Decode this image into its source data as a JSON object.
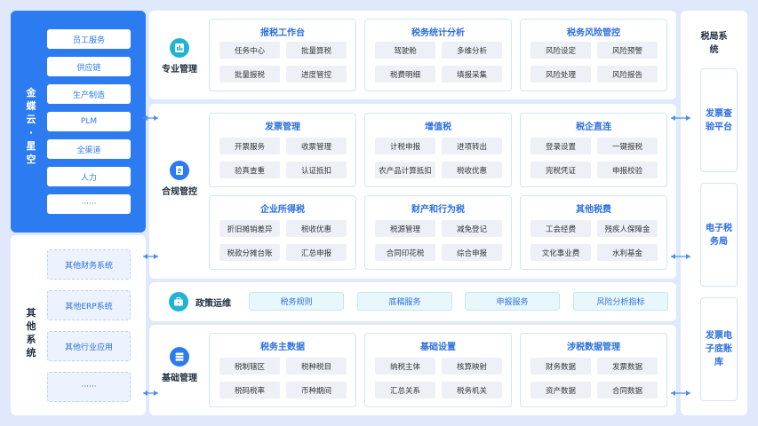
{
  "left": {
    "cloud_title": "金蝶云·星空",
    "cloud_items": [
      "员工服务",
      "供应链",
      "生产制造",
      "PLM",
      "全渠道",
      "人力",
      "······"
    ],
    "other_title": "其他系统",
    "other_items": [
      "其他财务系统",
      "其他ERP系统",
      "其他行业应用",
      "······"
    ]
  },
  "sections": {
    "professional": "专业管理",
    "compliance": "合规管控",
    "policy": "政策运维",
    "basic": "基础管理"
  },
  "boxes": {
    "tax_desk": {
      "title": "报税工作台",
      "items": [
        "任务中心",
        "批量算税",
        "批量报税",
        "进度管控"
      ]
    },
    "tax_stats": {
      "title": "税务统计分析",
      "items": [
        "驾驶舱",
        "多维分析",
        "税费明细",
        "填报采集"
      ]
    },
    "tax_risk": {
      "title": "税务风险管控",
      "items": [
        "风险设定",
        "风险预警",
        "风险处理",
        "风险报告"
      ]
    },
    "invoice": {
      "title": "发票管理",
      "items": [
        "开票服务",
        "收票管理",
        "验真查重",
        "认证抵扣"
      ]
    },
    "vat": {
      "title": "增值税",
      "items": [
        "计税申报",
        "进项转出",
        "农产品计算抵扣",
        "税收优惠"
      ]
    },
    "direct": {
      "title": "税企直连",
      "items": [
        "登录设置",
        "一键报税",
        "完税凭证",
        "申报校验"
      ]
    },
    "cit": {
      "title": "企业所得税",
      "items": [
        "折旧摊销差异",
        "税收优惠",
        "税款分摊台账",
        "汇总申报"
      ]
    },
    "property": {
      "title": "财产和行为税",
      "items": [
        "税源管理",
        "减免登记",
        "合同印花税",
        "综合申报"
      ]
    },
    "other_fees": {
      "title": "其他税费",
      "items": [
        "工会经费",
        "残疾人保障金",
        "文化事业费",
        "水利基金"
      ]
    },
    "master": {
      "title": "税务主数据",
      "items": [
        "税制辖区",
        "税种税目",
        "税码税率",
        "币种期间"
      ]
    },
    "basic_set": {
      "title": "基础设置",
      "items": [
        "纳税主体",
        "核算映射",
        "汇总关系",
        "税务机关"
      ]
    },
    "tax_data": {
      "title": "涉税数据管理",
      "items": [
        "财务数据",
        "发票数据",
        "资产数据",
        "合同数据"
      ]
    }
  },
  "policy_items": [
    "税务规则",
    "底稿服务",
    "申报服务",
    "风险分析指标"
  ],
  "right": {
    "title": "税局系统",
    "items": [
      "发票查验平台",
      "电子税务局",
      "发票电子底账库"
    ]
  },
  "colors": {
    "primary": "#2c7bf0",
    "background": "#dfe9fb",
    "chip": "#edf1f7"
  }
}
